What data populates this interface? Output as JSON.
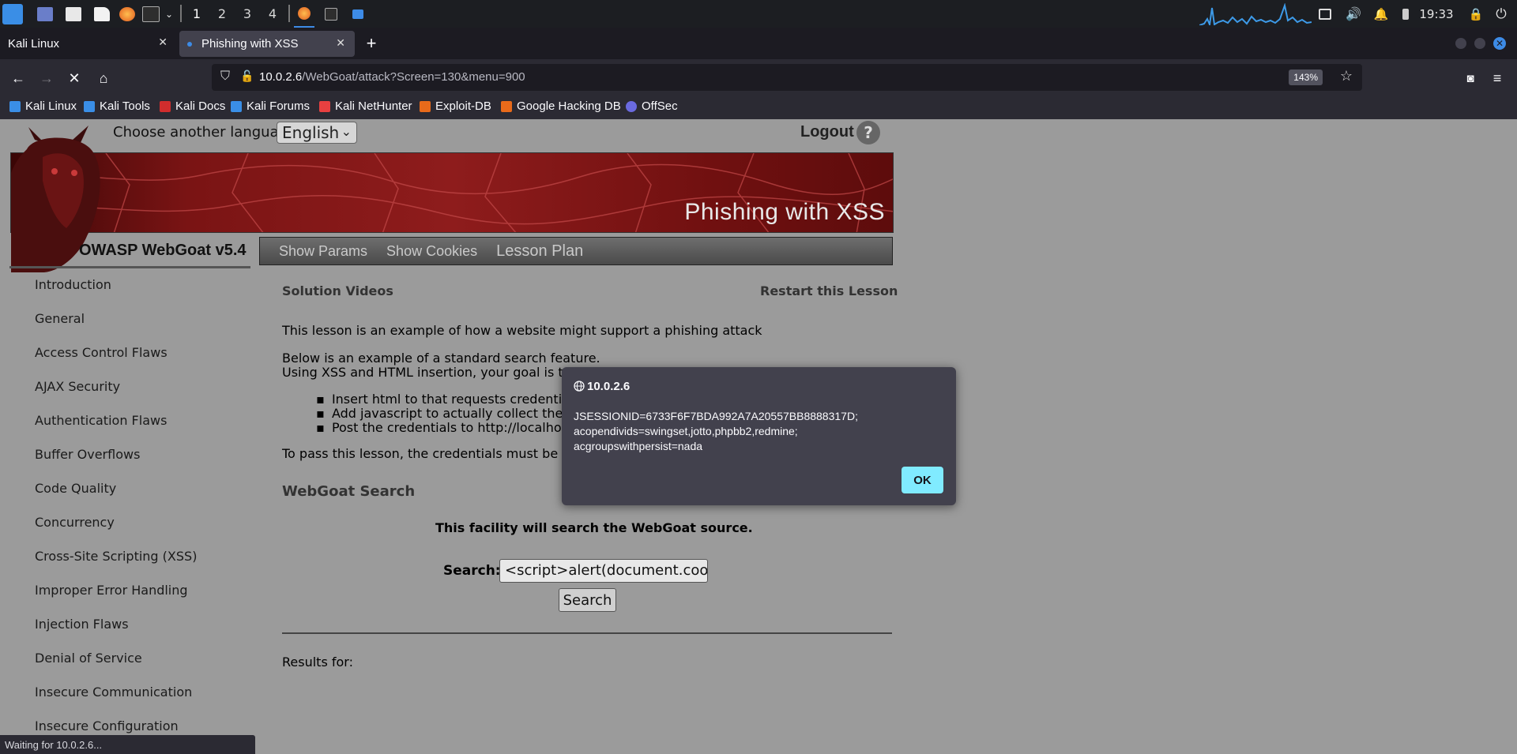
{
  "system_panel": {
    "workspaces": [
      "1",
      "2",
      "3",
      "4"
    ],
    "active_workspace": "1",
    "clock": "19:33"
  },
  "browser": {
    "tabs": [
      {
        "label": "Kali Linux",
        "active": false
      },
      {
        "label": "Phishing with XSS",
        "active": true
      }
    ],
    "url_host": "10.0.2.6",
    "url_path": "/WebGoat/attack?Screen=130&menu=900",
    "zoom": "143%",
    "bookmarks": [
      "Kali Linux",
      "Kali Tools",
      "Kali Docs",
      "Kali Forums",
      "Kali NetHunter",
      "Exploit-DB",
      "Google Hacking DB",
      "OffSec"
    ],
    "status": "Waiting for 10.0.2.6..."
  },
  "page": {
    "language_label": "Choose another language:",
    "language_value": "English",
    "logout": "Logout",
    "help": "?",
    "banner_title": "Phishing with XSS",
    "brand": "OWASP WebGoat  v5.4",
    "menu": [
      "Show Params",
      "Show Cookies",
      "Lesson Plan"
    ],
    "sidebar": [
      "Introduction",
      "General",
      "Access Control Flaws",
      "AJAX Security",
      "Authentication Flaws",
      "Buffer Overflows",
      "Code Quality",
      "Concurrency",
      "Cross-Site Scripting (XSS)",
      "Improper Error Handling",
      "Injection Flaws",
      "Denial of Service",
      "Insecure Communication",
      "Insecure Configuration"
    ],
    "solution_videos": "Solution Videos",
    "restart_lesson": "Restart this Lesson",
    "intro": "This lesson is an example of how a website might support a phishing attack",
    "below1": "Below is an example of a standard search feature.",
    "below2": "Using XSS and HTML insertion, your goal is to:",
    "bullets": [
      "Insert html to that requests credentials",
      "Add javascript to actually collect the cr",
      "Post the credentials to http://localhost/"
    ],
    "pass_text": "To pass this lesson, the credentials must be po",
    "search_heading": "WebGoat Search",
    "facility": "This facility will search the WebGoat source.",
    "search_label": "Search:",
    "search_value": "<script>alert(document.cookie",
    "search_button": "Search",
    "results": "Results for:"
  },
  "alert": {
    "origin": "10.0.2.6",
    "line1": "JSESSIONID=6733F6F7BDA992A7A20557BB8888317D;",
    "line2": "acopendivids=swingset,jotto,phpbb2,redmine;",
    "line3": "acgroupswithpersist=nada",
    "ok": "OK"
  }
}
